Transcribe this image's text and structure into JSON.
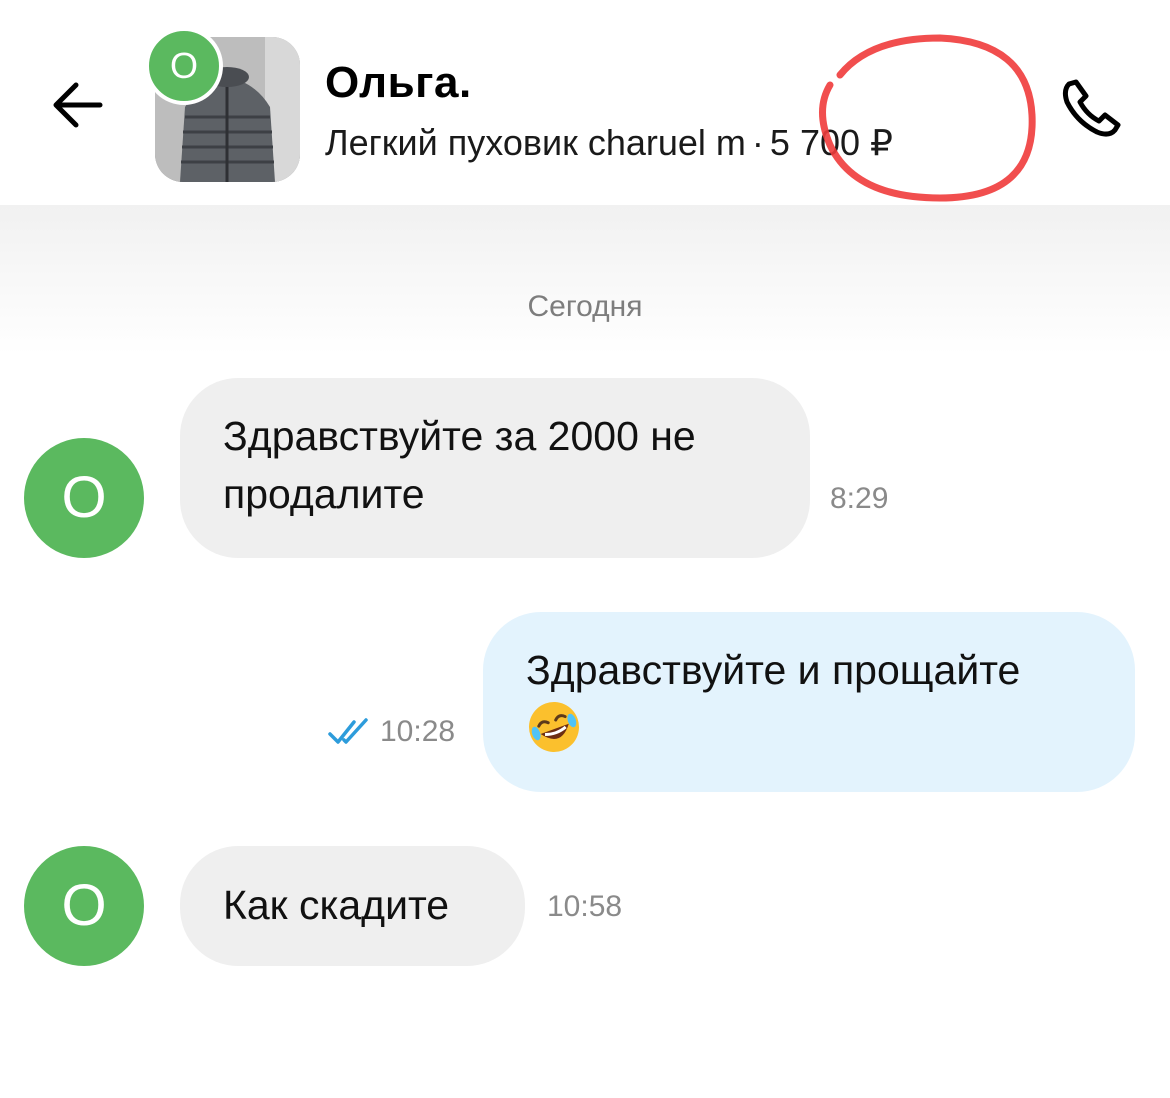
{
  "header": {
    "contact_name": "Ольга.",
    "ad_title": "Легкий пуховик charuel m",
    "separator": "·",
    "price": "5 700 ₽",
    "avatar_letter": "О"
  },
  "chat": {
    "date_label": "Сегодня",
    "messages": [
      {
        "direction": "incoming",
        "avatar_letter": "О",
        "line1": "Здравствуйте за 2000 не",
        "line2": "продалите",
        "time": "8:29"
      },
      {
        "direction": "outgoing",
        "line1": "Здравствуйте и прощайте",
        "emoji": "rolling-on-floor-laughing",
        "time": "10:28",
        "status": "read"
      },
      {
        "direction": "incoming",
        "avatar_letter": "О",
        "text": "Как скадите",
        "time": "10:58"
      }
    ]
  },
  "colors": {
    "avatar_green": "#5bb95f",
    "incoming_bubble": "#efefef",
    "outgoing_bubble": "#e3f3fd",
    "read_ticks": "#2d9cdb",
    "price_circle": "#ef3b3b"
  }
}
